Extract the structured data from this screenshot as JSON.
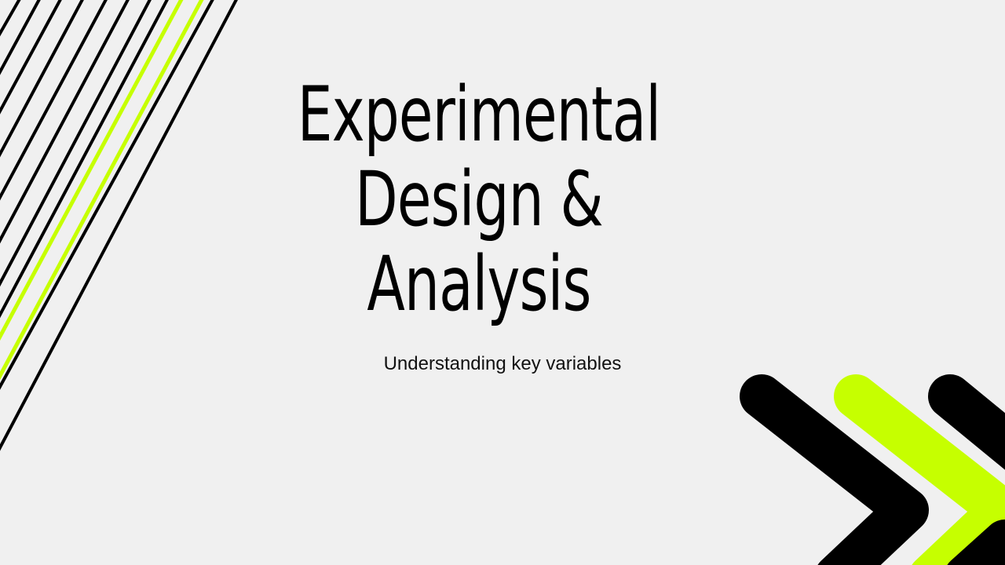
{
  "slide": {
    "title_lines": [
      "Experimental",
      "Design &",
      "Analysis"
    ],
    "subtitle": "Understanding key variables"
  },
  "colors": {
    "background": "#f0f0f0",
    "ink": "#000000",
    "accent": "#c6ff00"
  },
  "decor": {
    "left": "diagonal-lines",
    "right": "chevron-arrows"
  }
}
